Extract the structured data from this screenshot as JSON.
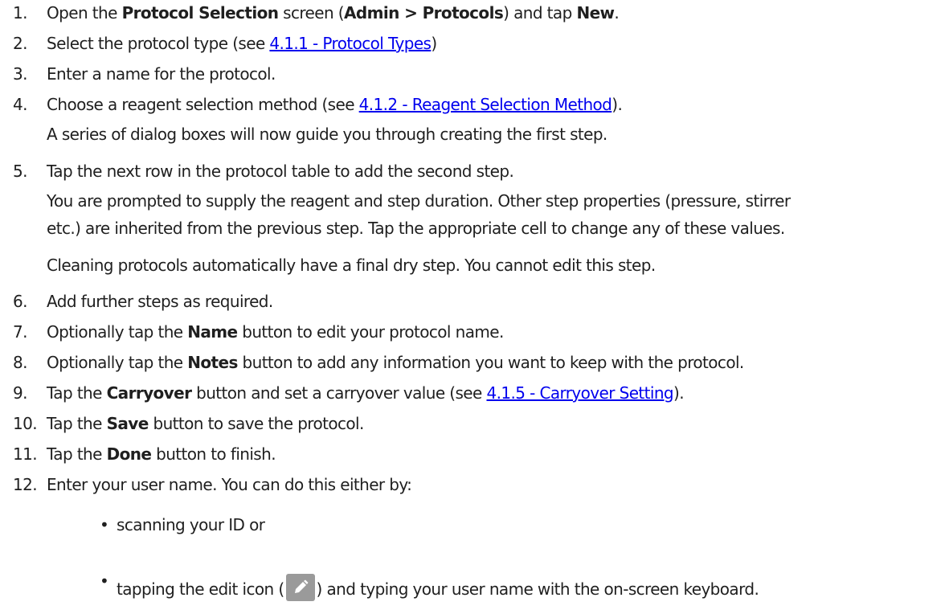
{
  "steps": [
    {
      "num": "1.",
      "a": "Open the ",
      "b1": "Protocol Selection",
      "c": " screen (",
      "b2": "Admin > Protocols",
      "d": ") and tap ",
      "b3": "New",
      "e": "."
    },
    {
      "num": "2.",
      "a": "Select the protocol type (see ",
      "link": "4.1.1 - Protocol Types",
      "e": ")"
    },
    {
      "num": "3.",
      "a": "Enter a name for the protocol."
    },
    {
      "num": "4.",
      "a": "Choose a reagent selection method (see ",
      "link": "4.1.2 - Reagent Selection Method",
      "e": ").",
      "sub": "A series of dialog boxes will now guide you through creating the first step."
    },
    {
      "num": "5.",
      "a": "Tap the next row in the protocol table to add the second step.",
      "sub1": "You are prompted to supply the reagent and step duration. Other step properties (pressure, stirrer",
      "sub2": "etc.) are inherited from the previous step. Tap the appropriate cell to change any of these values.",
      "sub3": "Cleaning protocols automatically have a final dry step. You cannot edit this step."
    },
    {
      "num": "6.",
      "a": "Add further steps as required."
    },
    {
      "num": "7.",
      "a": "Optionally tap the ",
      "b1": "Name",
      "e": " button to edit your protocol name."
    },
    {
      "num": "8.",
      "a": "Optionally tap the ",
      "b1": "Notes",
      "e": " button to add any information you want to keep with the protocol."
    },
    {
      "num": "9.",
      "a": "Tap the ",
      "b1": "Carryover",
      "c": " button and set a carryover value (see ",
      "link": "4.1.5 - Carryover Setting",
      "e": ")."
    },
    {
      "num": "10.",
      "a": "Tap the ",
      "b1": "Save",
      "e": " button to save the protocol."
    },
    {
      "num": "11.",
      "a": "Tap the ",
      "b1": "Done",
      "e": " button to finish."
    },
    {
      "num": "12.",
      "a": "Enter your user name. You can do this either by:"
    }
  ],
  "bullets": [
    {
      "dot": "•",
      "text": "scanning your ID or"
    },
    {
      "dot": "•",
      "pre": "tapping the edit icon (",
      "icon": "pencil-edit-icon",
      "post": ") and typing your user name with the on-screen keyboard."
    }
  ]
}
